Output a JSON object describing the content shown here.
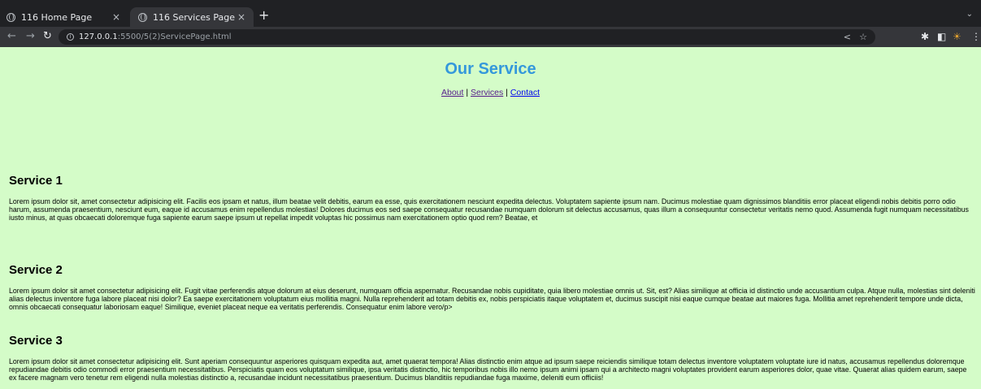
{
  "browser": {
    "tabs": [
      {
        "title": "116 Home Page",
        "active": false
      },
      {
        "title": "116 Services Page",
        "active": true
      }
    ],
    "new_tab": "+",
    "close": "×",
    "url_host": "127.0.0.1",
    "url_path": ":5500/5(2)ServicePage.html"
  },
  "page": {
    "title": "Our Service",
    "nav": {
      "about": "About",
      "sep1": " | ",
      "services": "Services",
      "sep2": " | ",
      "contact": "Contact"
    },
    "services": [
      {
        "heading": "Service 1",
        "body": "Lorem ipsum dolor sit, amet consectetur adipisicing elit. Facilis eos ipsam et natus, illum beatae velit debitis, earum ea esse, quis exercitationem nesciunt expedita delectus. Voluptatem sapiente ipsum nam. Ducimus molestiae quam dignissimos blanditiis error placeat eligendi nobis debitis porro odio harum, assumenda praesentium, nesciunt eum, eaque id accusamus enim repellendus molestias! Dolores ducimus eos sed saepe consequatur recusandae numquam dolorum sit delectus accusamus, quas illum a consequuntur consectetur veritatis nemo quod. Assumenda fugit numquam necessitatibus iusto minus, at quas obcaecati doloremque fuga sapiente earum saepe ipsum ut repellat impedit voluptas hic possimus nam exercitationem optio quod rem? Beatae, et"
      },
      {
        "heading": "Service 2",
        "body": "Lorem ipsum dolor sit amet consectetur adipisicing elit. Fugit vitae perferendis atque dolorum at eius deserunt, numquam officia aspernatur. Recusandae nobis cupiditate, quia libero molestiae omnis ut. Sit, est? Alias similique at officia id distinctio unde accusantium culpa. Atque nulla, molestias sint deleniti alias delectus inventore fuga labore placeat nisi dolor? Ea saepe exercitationem voluptatum eius mollitia magni. Nulla reprehenderit ad totam debitis ex, nobis perspiciatis itaque voluptatem et, ducimus suscipit nisi eaque cumque beatae aut maiores fuga. Mollitia amet reprehenderit tempore unde dicta, omnis obcaecati consequatur laboriosam eaque! Similique, eveniet placeat neque ea veritatis perferendis. Consequatur enim labore vero/p>"
      },
      {
        "heading": "Service 3",
        "body": "Lorem ipsum dolor sit amet consectetur adipisicing elit. Sunt aperiam consequuntur asperiores quisquam expedita aut, amet quaerat tempora! Alias distinctio enim atque ad ipsum saepe reiciendis similique totam delectus inventore voluptatem voluptate iure id natus, accusamus repellendus doloremque repudiandae debitis odio commodi error praesentium necessitatibus. Perspiciatis quam eos voluptatum similique, ipsa veritatis distinctio, hic temporibus nobis illo nemo ipsum animi ipsam qui a architecto magni voluptates provident earum asperiores dolor, quae vitae. Quaerat alias quidem earum, saepe ex facere magnam vero tenetur rem eligendi nulla molestias distinctio a, recusandae incidunt necessitatibus praesentium. Ducimus blanditiis repudiandae fuga maxime, deleniti eum officiis!"
      }
    ]
  }
}
